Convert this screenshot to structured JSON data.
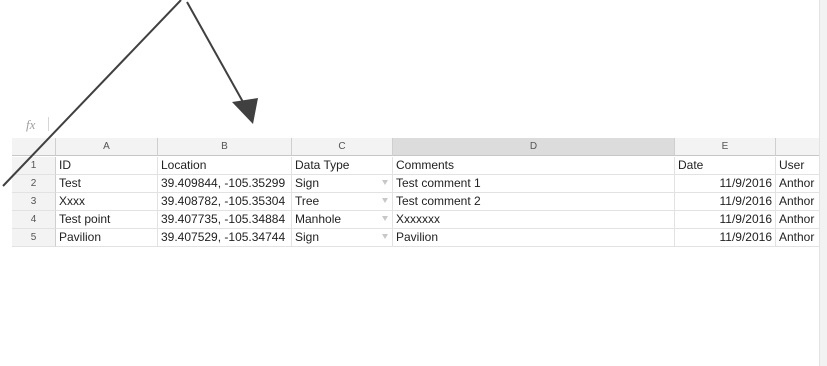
{
  "formula_bar": {
    "fx_label": "fx"
  },
  "columns": [
    "A",
    "B",
    "C",
    "D",
    "E"
  ],
  "rows": [
    {
      "num": "1",
      "id": "ID",
      "location": "Location",
      "data_type": "Data Type",
      "comments": "Comments",
      "date": "Date",
      "user": "User"
    },
    {
      "num": "2",
      "id": "Test",
      "location": "39.409844, -105.35299",
      "data_type": "Sign",
      "comments": "Test comment 1",
      "date": "11/9/2016",
      "user": "Anthor"
    },
    {
      "num": "3",
      "id": "Xxxx",
      "location": "39.408782, -105.35304",
      "data_type": "Tree",
      "comments": "Test comment 2",
      "date": "11/9/2016",
      "user": "Anthor"
    },
    {
      "num": "4",
      "id": "Test point",
      "location": "39.407735, -105.34884",
      "data_type": "Manhole",
      "comments": "Xxxxxxx",
      "date": "11/9/2016",
      "user": "Anthor"
    },
    {
      "num": "5",
      "id": "Pavilion",
      "location": "39.407529, -105.34744",
      "data_type": "Sign",
      "comments": "Pavilion",
      "date": "11/9/2016",
      "user": "Anthor"
    }
  ],
  "colors": {
    "arrow": "#404040",
    "selection_accent": "#4a86e8",
    "selected_header": "#dcdcdc"
  }
}
